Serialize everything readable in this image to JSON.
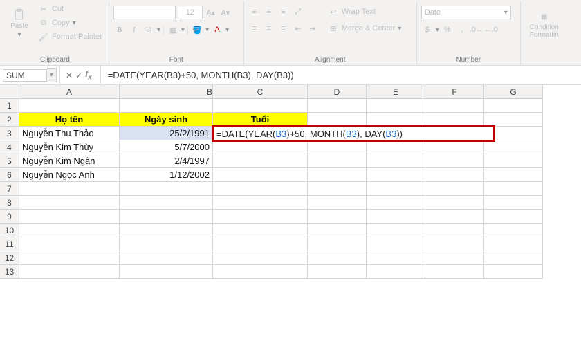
{
  "ribbon": {
    "clipboard": {
      "paste": "Paste",
      "cut": "Cut",
      "copy": "Copy",
      "format_painter": "Format Painter",
      "group": "Clipboard"
    },
    "font": {
      "font_name_placeholder": "",
      "font_size": "12",
      "bold": "B",
      "italic": "I",
      "underline": "U",
      "group": "Font"
    },
    "alignment": {
      "wrap": "Wrap Text",
      "merge": "Merge & Center",
      "group": "Alignment"
    },
    "number": {
      "format_name": "Date",
      "group": "Number"
    },
    "styles": {
      "cond": "Condition\nFormattin",
      "group": ""
    }
  },
  "formula_bar": {
    "name_box": "SUM",
    "formula_text": "=DATE(YEAR(B3)+50, MONTH(B3), DAY(B3))"
  },
  "columns": [
    "A",
    "B",
    "C",
    "D",
    "E",
    "F",
    "G"
  ],
  "headers": {
    "A": "Họ tên",
    "B": "Ngày sinh",
    "C": "Tuổi"
  },
  "data_rows": [
    {
      "r": 3,
      "A": "Nguyễn Thu Thảo",
      "B": "25/2/1991"
    },
    {
      "r": 4,
      "A": "Nguyễn Kim Thùy",
      "B": "5/7/2000"
    },
    {
      "r": 5,
      "A": "Nguyễn Kim Ngân",
      "B": "2/4/1997"
    },
    {
      "r": 6,
      "A": "Nguyễn Ngọc Anh",
      "B": "1/12/2002"
    }
  ],
  "editing_formula": {
    "prefix": "=DATE(YEAR(",
    "ref1": "B3",
    "mid1": ")+50, MONTH(",
    "ref2": "B3",
    "mid2": "), DAY(",
    "ref3": "B3",
    "suffix": "))"
  }
}
